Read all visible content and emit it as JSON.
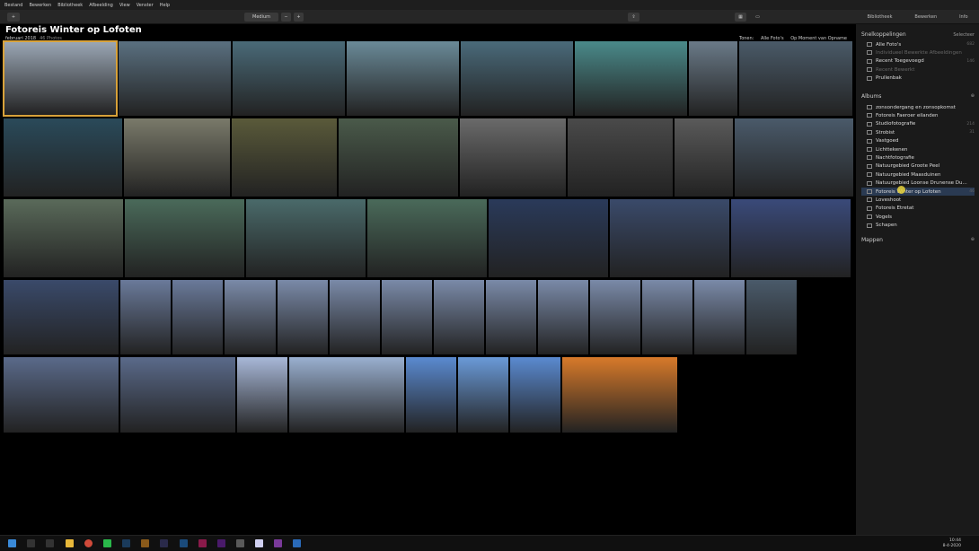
{
  "menu": [
    "Bestand",
    "Bewerken",
    "Bibliotheek",
    "Afbeelding",
    "View",
    "Venster",
    "Help"
  ],
  "toolbar": {
    "add": "+",
    "size": "Medium",
    "minus": "−",
    "plus": "+"
  },
  "panel_tabs": [
    "Bibliotheek",
    "Bewerken",
    "Info"
  ],
  "album": {
    "title": "Fotoreis Winter op Lofoten",
    "date": "februari 2018",
    "count": "46 Photos"
  },
  "sort": {
    "label": "Tonen:",
    "filter": "Alle Foto's",
    "order": "Op Moment van Opname"
  },
  "shortcuts": {
    "title": "Snelkoppelingen",
    "action": "Selecteer",
    "items": [
      {
        "label": "Alle Foto's",
        "count": "682"
      },
      {
        "label": "Individueel Bewerkte Afbeeldingen",
        "count": "",
        "dim": true
      },
      {
        "label": "Recent Toegevoegd",
        "count": "146"
      },
      {
        "label": "Recent Bewerkt",
        "count": "",
        "dim": true
      },
      {
        "label": "Prullenbak",
        "count": ""
      }
    ]
  },
  "albums": {
    "title": "Albums",
    "items": [
      {
        "label": "zonsondergang en zonsopkomst",
        "count": ""
      },
      {
        "label": "Fotoreis Faeroer eilanden",
        "count": ""
      },
      {
        "label": "Studiofotografie",
        "count": "214"
      },
      {
        "label": "Strobist",
        "count": "31"
      },
      {
        "label": "Vastgoed",
        "count": ""
      },
      {
        "label": "Lichttekenen",
        "count": ""
      },
      {
        "label": "Nachtfotografie",
        "count": ""
      },
      {
        "label": "Natuurgebied Groote Peel",
        "count": ""
      },
      {
        "label": "Natuurgebied Maasduinen",
        "count": ""
      },
      {
        "label": "Natuurgebied Loonse Drunense Du...",
        "count": ""
      },
      {
        "label": "Fotoreis Winter op Lofoten",
        "count": "46",
        "active": true
      },
      {
        "label": "Loveshoot",
        "count": ""
      },
      {
        "label": "Fotoreis Etretat",
        "count": ""
      },
      {
        "label": "Vogels",
        "count": ""
      },
      {
        "label": "Schapen",
        "count": ""
      }
    ]
  },
  "folders": {
    "title": "Mappen"
  },
  "tray": {
    "time": "10:44",
    "date": "8-4-2020"
  },
  "colors": {
    "accent": "#d8a23a",
    "active": "#2a3a52"
  }
}
